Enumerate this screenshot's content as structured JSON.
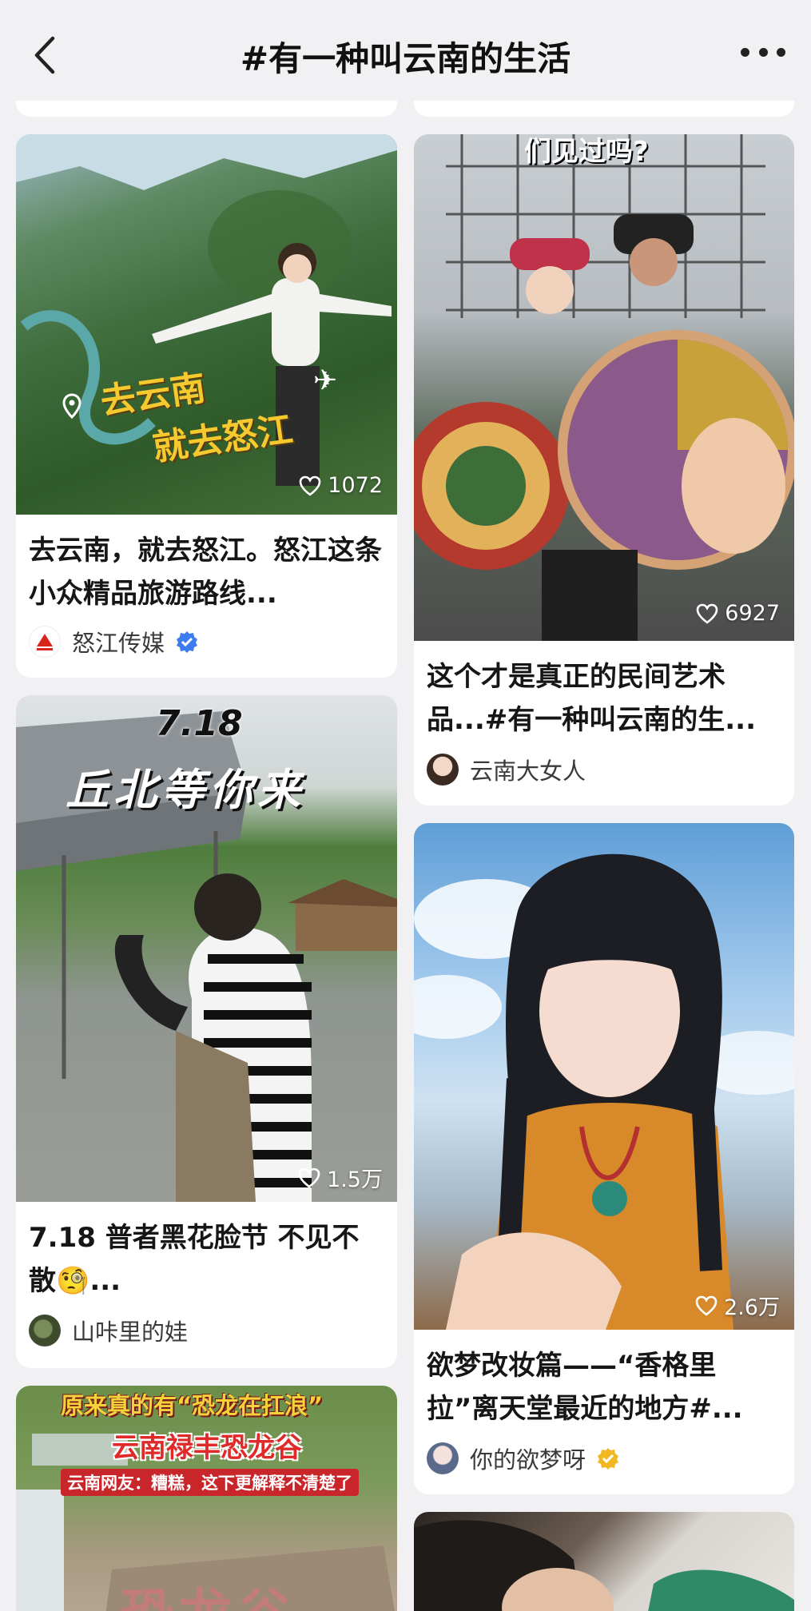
{
  "header": {
    "title": "#有一种叫云南的生活"
  },
  "cards": [
    {
      "image_text_line1": "去云南",
      "image_text_line2": "就去怒江",
      "likes": "1072",
      "caption": "去云南，就去怒江。怒江这条小众精品旅游路线...",
      "author": "怒江传媒",
      "verified": "blue"
    },
    {
      "image_text": "们见过吗?",
      "likes": "6927",
      "caption": "这个才是真正的民间艺术品...#有一种叫云南的生...",
      "author": "云南大女人"
    },
    {
      "image_text_line1": "7.18",
      "image_text_line2": "丘北等你来",
      "likes": "1.5万",
      "caption": "7.18 普者黑花脸节 不见不散🧐...",
      "author": "山咔里的娃"
    },
    {
      "likes": "2.6万",
      "caption": "欲梦改妆篇——“香格里拉”离天堂最近的地方#...",
      "author": "你的欲梦呀",
      "verified": "gold"
    },
    {
      "image_text_line1": "原来真的有“恐龙在扛浪”",
      "image_text_line2": "云南禄丰恐龙谷",
      "image_text_line3": "云南网友：糟糕，这下更解释不清楚了",
      "image_text_line4": "恐龙谷"
    }
  ]
}
